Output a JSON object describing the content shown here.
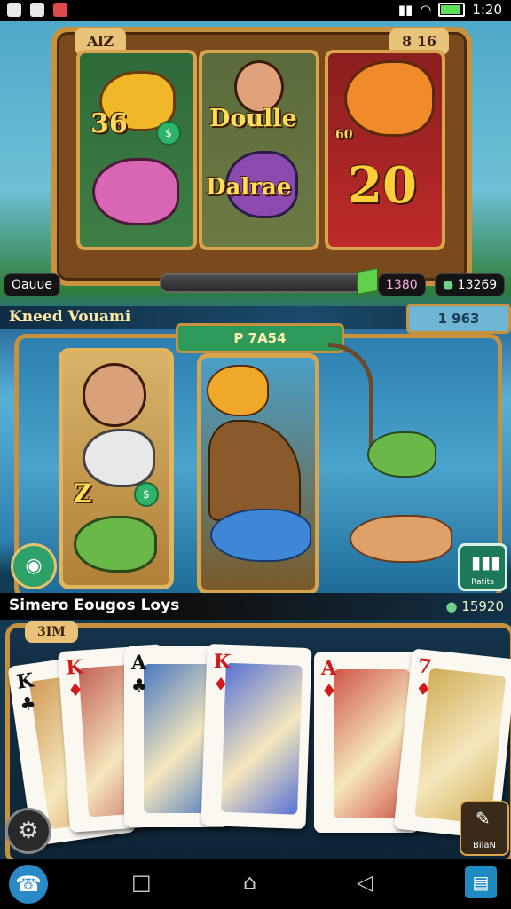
{
  "status_bar": {
    "time": "1:20",
    "battery_level": 0.85
  },
  "slot_panel": {
    "top_left_label": "AlZ",
    "top_right_label": "8 16",
    "reel1": {
      "symbol_text": "36"
    },
    "reel2": {
      "line1": "Doulle",
      "line2": "Dalrae"
    },
    "reel3": {
      "corner_text": "60",
      "big_number": "20"
    },
    "bottom_left_pill": "Oauue",
    "xp_value": "1380",
    "coin_balance": "13269"
  },
  "fishing_panel": {
    "title": "Kneed Vouami",
    "counter_top": "1 963",
    "counter_center": "P 7A54",
    "side_reel_text": "Z"
  },
  "card_panel": {
    "title": "Simero Eougos Loys",
    "coin_text": "15920",
    "top_label": "3IM",
    "chart_button_label": "Ratits",
    "edit_button_label": "BilaN",
    "cards": [
      {
        "rank": "K",
        "suit": "♣",
        "color": "#111111"
      },
      {
        "rank": "K",
        "suit": "♦",
        "color": "#d11a1a"
      },
      {
        "rank": "A",
        "suit": "♣",
        "color": "#111111"
      },
      {
        "rank": "K",
        "suit": "♦",
        "color": "#d11a1a"
      },
      {
        "rank": "A",
        "suit": "♦",
        "color": "#d11a1a"
      },
      {
        "rank": "7",
        "suit": "♦",
        "color": "#d11a1a"
      }
    ]
  },
  "icons": {
    "camera": "camera-icon",
    "chart": "bar-chart-icon",
    "settings": "gear-icon",
    "edit": "pencil-icon",
    "nav_back": "back-icon",
    "nav_home": "home-icon",
    "nav_recent": "square-icon",
    "nav_app": "app-icon"
  }
}
